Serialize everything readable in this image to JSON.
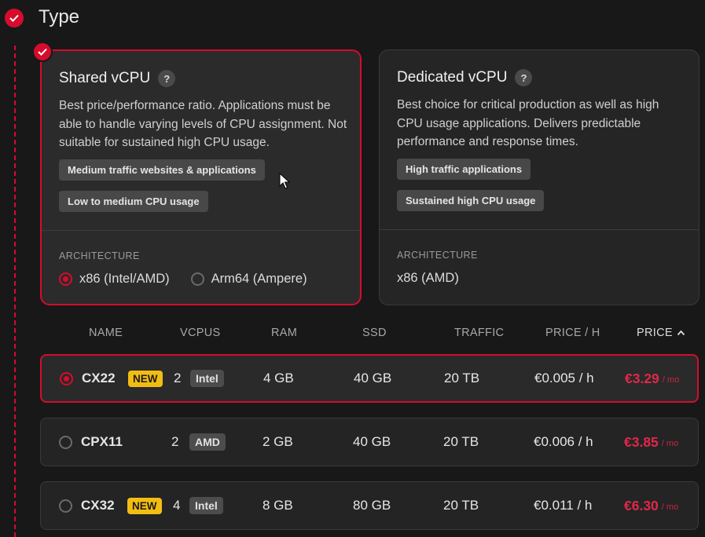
{
  "section": {
    "title": "Type"
  },
  "cards": [
    {
      "title": "Shared vCPU",
      "help": "?",
      "desc": "Best price/performance ratio. Applications must be able to handle varying levels of CPU assignment. Not suitable for sustained high CPU usage.",
      "tags": [
        "Medium traffic websites & applications",
        "Low to medium CPU usage"
      ],
      "arch_label": "ARCHITECTURE",
      "arch_options": [
        "x86 (Intel/AMD)",
        "Arm64 (Ampere)"
      ],
      "selected": true
    },
    {
      "title": "Dedicated vCPU",
      "help": "?",
      "desc": "Best choice for critical production as well as high CPU usage applications. Delivers predictable performance and response times.",
      "tags": [
        "High traffic applications",
        "Sustained high CPU usage"
      ],
      "arch_label": "ARCHITECTURE",
      "arch_value": "x86 (AMD)",
      "selected": false
    }
  ],
  "table": {
    "headers": [
      "NAME",
      "VCPUS",
      "RAM",
      "SSD",
      "TRAFFIC",
      "PRICE / H",
      "PRICE"
    ],
    "sort_column": "PRICE",
    "rows": [
      {
        "name": "CX22",
        "badge": "NEW",
        "vcpus": "2",
        "cpu": "Intel",
        "ram": "4 GB",
        "ssd": "40 GB",
        "traffic": "20 TB",
        "price_h": "€0.005 / h",
        "price": "€3.29",
        "per": "/ mo",
        "selected": true
      },
      {
        "name": "CPX11",
        "badge": "",
        "vcpus": "2",
        "cpu": "AMD",
        "ram": "2 GB",
        "ssd": "40 GB",
        "traffic": "20 TB",
        "price_h": "€0.006 / h",
        "price": "€3.85",
        "per": "/ mo",
        "selected": false
      },
      {
        "name": "CX32",
        "badge": "NEW",
        "vcpus": "4",
        "cpu": "Intel",
        "ram": "8 GB",
        "ssd": "80 GB",
        "traffic": "20 TB",
        "price_h": "€0.011 / h",
        "price": "€6.30",
        "per": "/ mo",
        "selected": false
      }
    ]
  },
  "colors": {
    "accent": "#d50c2d",
    "price": "#e0284a",
    "new_badge": "#f2bd13",
    "background": "#181818"
  }
}
